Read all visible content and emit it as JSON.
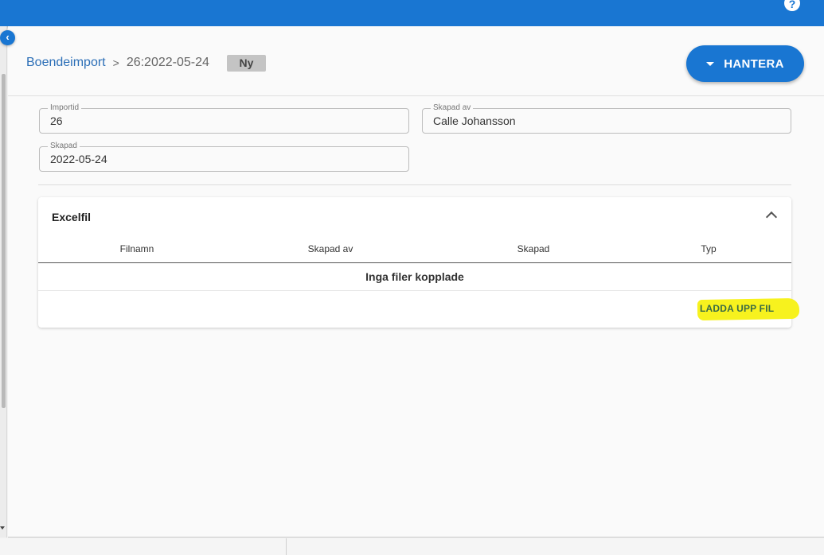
{
  "header": {
    "help_icon": "?"
  },
  "breadcrumb": {
    "root": "Boendeimport",
    "separator": ">",
    "current": "26:2022-05-24"
  },
  "status": {
    "label": "Ny"
  },
  "actions": {
    "manage_label": "HANTERA"
  },
  "form": {
    "import_id": {
      "label": "Importid",
      "value": "26"
    },
    "created_by": {
      "label": "Skapad av",
      "value": "Calle Johansson"
    },
    "created": {
      "label": "Skapad",
      "value": "2022-05-24"
    }
  },
  "excel_section": {
    "title": "Excelfil",
    "columns": [
      "Filnamn",
      "Skapad av",
      "Skapad",
      "Typ"
    ],
    "empty_text": "Inga filer kopplade",
    "upload_label": "LADDA UPP FIL"
  },
  "colors": {
    "primary": "#1976d2",
    "chip_bg": "#c4c4c4",
    "highlight": "#f7f21e"
  },
  "icons": {
    "collapse": "chevron-left-icon",
    "manage": "caret-down-icon",
    "section_toggle": "chevron-up-icon",
    "help": "help-icon"
  }
}
